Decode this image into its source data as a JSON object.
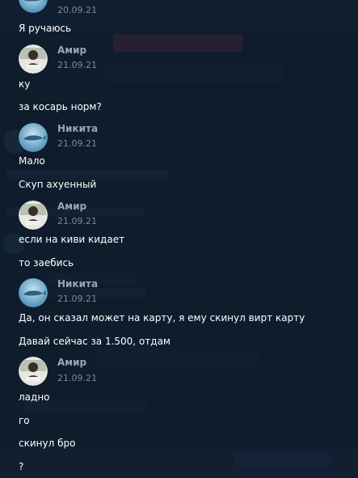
{
  "chat": {
    "messages": [
      {
        "avatar": "whale-avatar",
        "author": "",
        "date": "20.09.21",
        "lines": [
          "Я ручаюсь"
        ]
      },
      {
        "avatar": "amir-avatar",
        "author": "Амир",
        "date": "21.09.21",
        "lines": [
          "ку",
          "за косарь норм?"
        ]
      },
      {
        "avatar": "whale-avatar",
        "author": "Никита",
        "date": "21.09.21",
        "lines": [
          "Мало",
          "Скуп ахуенный"
        ]
      },
      {
        "avatar": "amir-avatar",
        "author": "Амир",
        "date": "21.09.21",
        "lines": [
          "если на киви кидает",
          "то заебись"
        ]
      },
      {
        "avatar": "whale-avatar",
        "author": "Никита",
        "date": "21.09.21",
        "lines": [
          "Да, он сказал может на карту, я ему скинул вирт карту",
          "Давай сейчас за 1.500, отдам"
        ]
      },
      {
        "avatar": "amir-avatar",
        "author": "Амир",
        "date": "21.09.21",
        "lines": [
          "ладно",
          "го",
          "скинул бро",
          "?"
        ]
      }
    ]
  }
}
